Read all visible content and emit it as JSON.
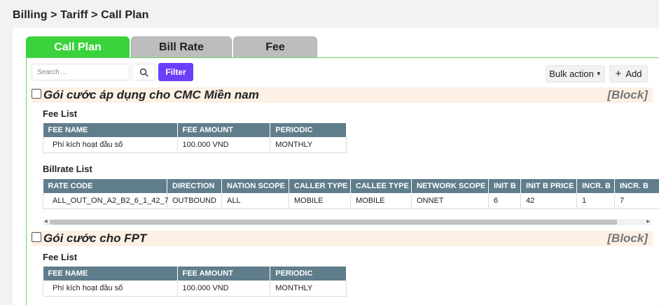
{
  "breadcrumb": "Billing > Tariff > Call Plan",
  "tabs": [
    "Call Plan",
    "Bill Rate",
    "Fee"
  ],
  "toolbar": {
    "search_placeholder": "Search ...",
    "filter_label": "Filter",
    "bulk_action_label": "Bulk action",
    "add_label": "Add"
  },
  "plans": [
    {
      "title": "Gói cước áp dụng cho CMC Miền nam",
      "status": "[Block]",
      "fee_list_title": "Fee List",
      "fee_columns": [
        "FEE NAME",
        "FEE AMOUNT",
        "PERIODIC"
      ],
      "fee_rows": [
        [
          "Phí kích hoạt đầu số",
          "100.000 VND",
          "MONTHLY"
        ]
      ],
      "billrate_list_title": "Billrate List",
      "billrate_columns": [
        "RATE CODE",
        "DIRECTION",
        "NATION SCOPE",
        "CALLER TYPE",
        "CALLEE TYPE",
        "NETWORK SCOPE",
        "INIT B",
        "INIT B PRICE",
        "INCR. B",
        "INCR. B"
      ],
      "billrate_rows": [
        [
          "ALL_OUT_ON_A2_B2_6_1_42_7",
          "OUTBOUND",
          "ALL",
          "MOBILE",
          "MOBILE",
          "ONNET",
          "6",
          "42",
          "1",
          "7"
        ]
      ]
    },
    {
      "title": "Gói cước cho FPT",
      "status": "[Block]",
      "fee_list_title": "Fee List",
      "fee_columns": [
        "FEE NAME",
        "FEE AMOUNT",
        "PERIODIC"
      ],
      "fee_rows": [
        [
          "Phí kích hoạt đầu số",
          "100.000 VND",
          "MONTHLY"
        ]
      ]
    }
  ]
}
